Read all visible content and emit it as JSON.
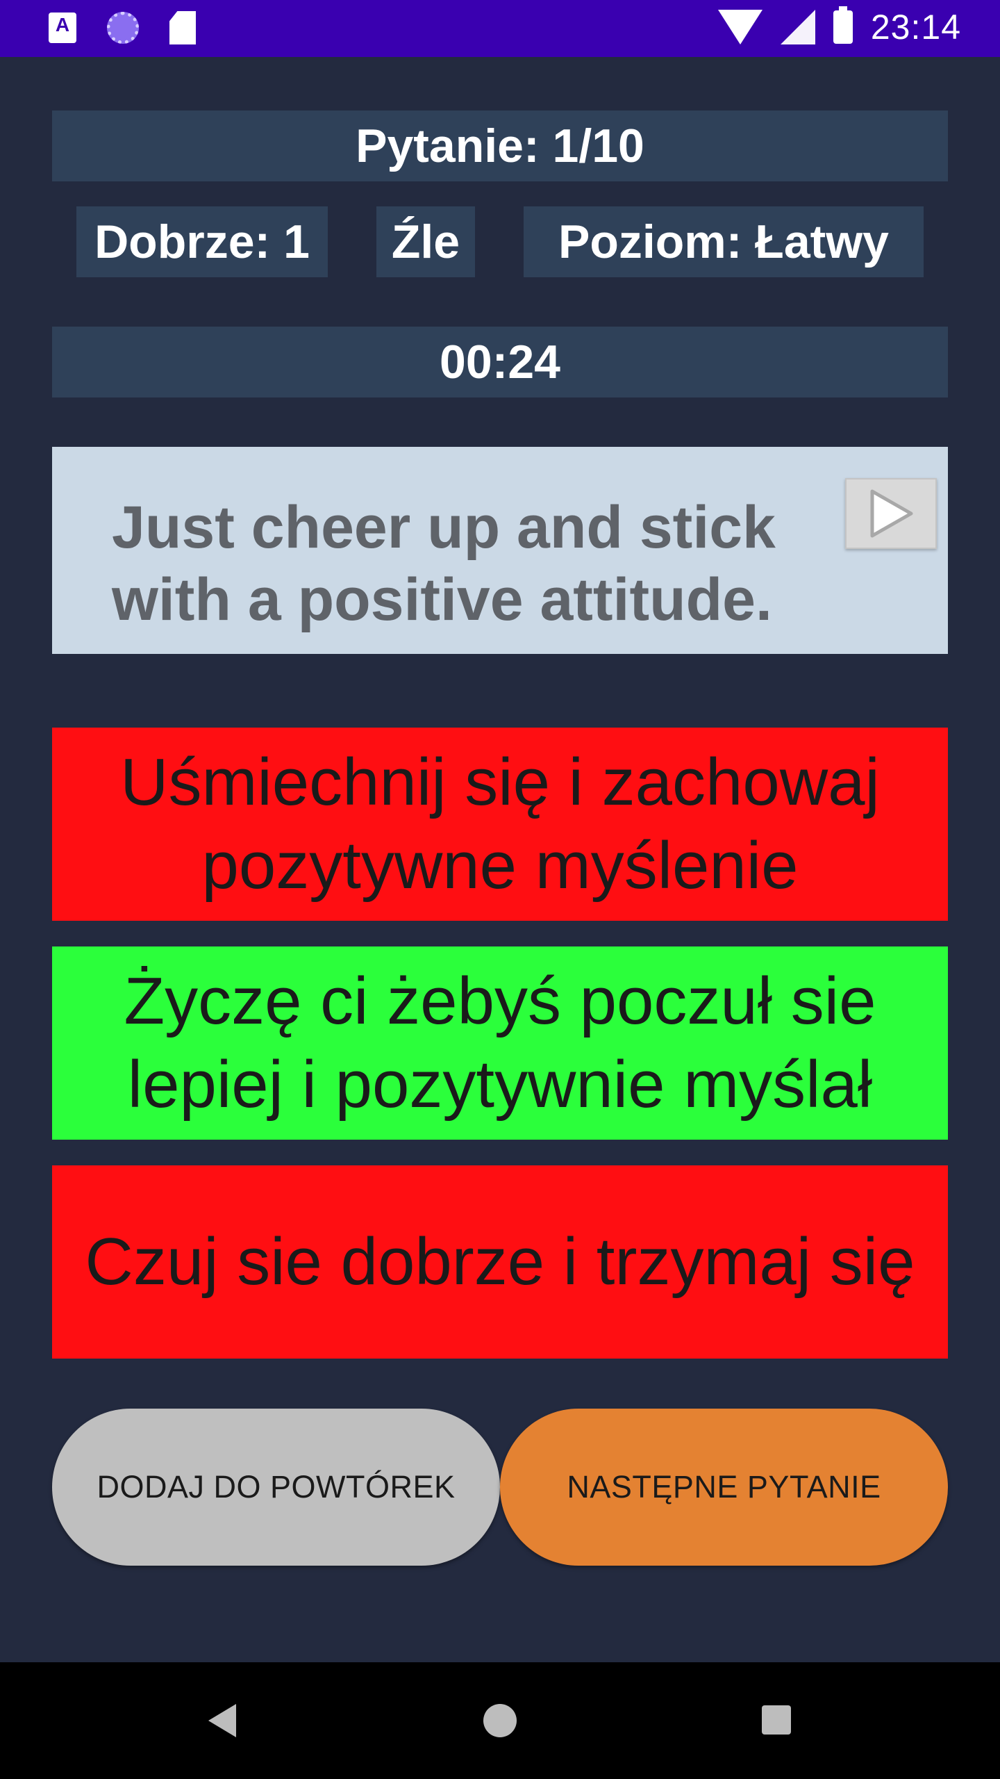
{
  "status_bar": {
    "time": "23:14",
    "icons": [
      "app-notification-icon",
      "sync-icon",
      "sd-card-icon",
      "wifi-icon",
      "signal-icon",
      "battery-icon"
    ]
  },
  "header": {
    "question_counter": "Pytanie: 1/10",
    "correct": "Dobrze: 1",
    "wrong": "Źle",
    "level": "Poziom: Łatwy",
    "timer": "00:24"
  },
  "question": {
    "text": "Just cheer up and stick with a positive attitude.",
    "play_icon": "play-icon"
  },
  "answers": [
    {
      "text": "Uśmiechnij się i zachowaj pozytywne myślenie",
      "state": "wrong",
      "color": "#ff0e12"
    },
    {
      "text": "Życzę ci żebyś poczuł sie lepiej i pozytywnie myślał",
      "state": "correct",
      "color": "#2bff3b"
    },
    {
      "text": "Czuj sie dobrze i trzymaj się",
      "state": "wrong",
      "color": "#ff0e12"
    }
  ],
  "buttons": {
    "add_to_review": "DODAJ DO POWTÓREK",
    "next_question": "NASTĘPNE PYTANIE"
  },
  "colors": {
    "background": "#232a3f",
    "status_bar": "#3a00b0",
    "info_box": "#2f4159",
    "question_card": "#cbd9e6",
    "add_button": "#bfbfbf",
    "next_button": "#e48232"
  },
  "nav_bar": {
    "icons": [
      "back-icon",
      "home-icon",
      "recents-icon"
    ]
  }
}
